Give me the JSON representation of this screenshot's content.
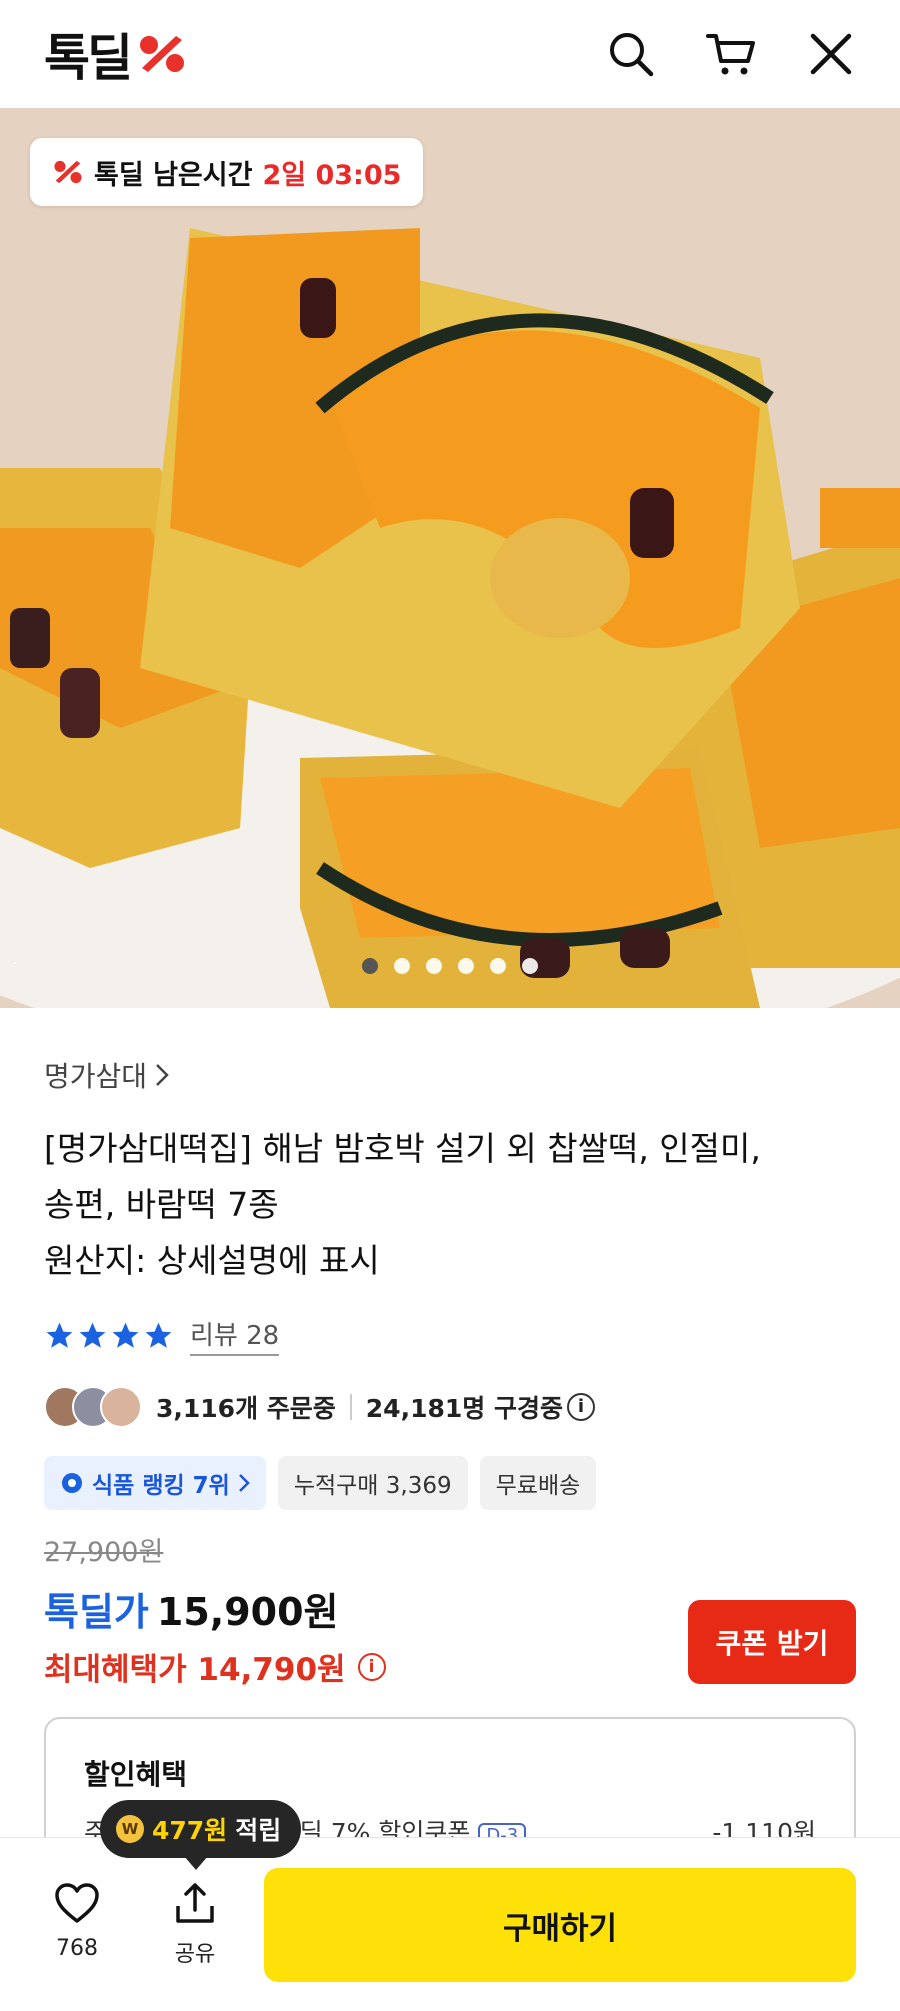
{
  "header": {
    "logo_text": "톡딜",
    "icons": [
      "search-icon",
      "cart-icon",
      "close-icon"
    ]
  },
  "hero": {
    "timer_prefix": "톡딜 남은시간",
    "timer_remaining": "2일 03:05",
    "image_subject": "pumpkin rice cake",
    "slide_count": 6,
    "active_slide": 1
  },
  "product": {
    "brand": "명가삼대",
    "title_line1": "[명가삼대떡집] 해남 밤호박 설기 외 찹쌀떡, 인절미,",
    "title_line2": "송편, 바람떡 7종",
    "origin": "원산지: 상세설명에 표시",
    "rating_stars": 4,
    "review_label": "리뷰 28",
    "orders": "3,116개 주문중",
    "viewers": "24,181명 구경중",
    "chips": {
      "ranking": "식품 랭킹 7위",
      "cumulative": "누적구매 3,369",
      "shipping": "무료배송"
    }
  },
  "price": {
    "original": "27,900원",
    "deal_label": "톡딜가",
    "deal_value": "15,900원",
    "max_benefit": "최대혜택가 14,790원",
    "coupon_button": "쿠폰 받기"
  },
  "discount": {
    "title": "할인혜택",
    "row_label": "주문 시 자동 적용 톡딜 7% 할인쿠폰",
    "row_badge": "D-3",
    "row_value": "-1,110원"
  },
  "points_tooltip": {
    "amount": "477원",
    "suffix": "적립"
  },
  "bottom": {
    "like_count": "768",
    "share_label": "공유",
    "buy_label": "구매하기"
  },
  "colors": {
    "accent_blue": "#1a62e0",
    "accent_red": "#e62a16",
    "buy_yellow": "#ffe10a"
  }
}
